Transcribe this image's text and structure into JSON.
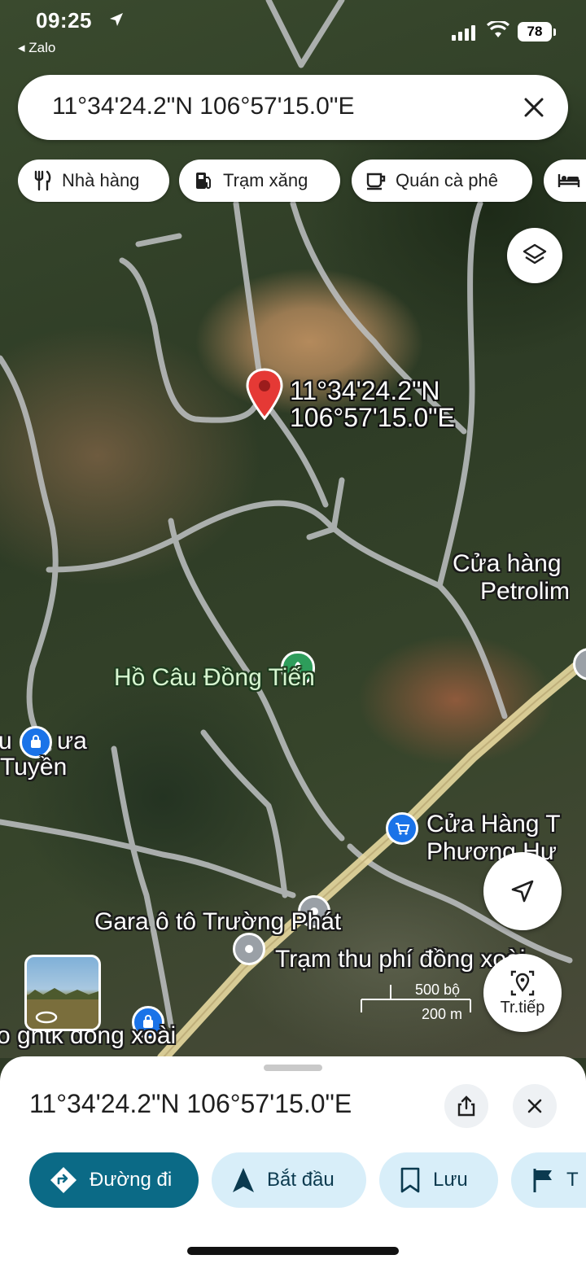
{
  "status_bar": {
    "time": "09:25",
    "back_app": "Zalo",
    "battery": "78"
  },
  "search": {
    "query": "11°34'24.2\"N 106°57'15.0\"E"
  },
  "chips": [
    {
      "label": "Nhà hàng",
      "icon": "restaurant-icon"
    },
    {
      "label": "Trạm xăng",
      "icon": "gas-station-icon"
    },
    {
      "label": "Quán cà phê",
      "icon": "coffee-icon"
    },
    {
      "label": "",
      "icon": "hotel-icon"
    }
  ],
  "map": {
    "pin_label_line1": "11°34'24.2\"N",
    "pin_label_line2": "106°57'15.0\"E",
    "labels": {
      "cua_hang_petrolimex_1": "Cửa hàng",
      "cua_hang_petrolimex_2": "Petrolim",
      "ho_cau": "Hồ Câu Đồng Tiến",
      "left_poi_1": "u",
      "left_poi_1b": "ưa",
      "left_poi_2": "Tuyền",
      "cua_hang_t_1": "Cửa Hàng T",
      "cua_hang_t_2": "Phương Hư",
      "gara": "Gara ô tô Trường Phát",
      "tram_thu_phi": "Trạm thu phí đồng xoài",
      "bottom_left": "o gntk đồng xoài"
    },
    "scale": {
      "top": "500 bộ",
      "bottom": "200 m"
    },
    "next_button": "Tr.tiếp",
    "colors": {
      "road": "#c8c8c8",
      "highway": "#e8d9a0",
      "pin": "#e53935",
      "poi_blue": "#1a73e8",
      "poi_green": "#2e9d5b",
      "poi_gray": "#9aa0a6"
    }
  },
  "sheet": {
    "title": "11°34'24.2\"N 106°57'15.0\"E",
    "actions": [
      {
        "label": "Đường đi",
        "icon": "directions-icon"
      },
      {
        "label": "Bắt đầu",
        "icon": "navigation-arrow-icon"
      },
      {
        "label": "Lưu",
        "icon": "bookmark-icon"
      },
      {
        "label": "T",
        "icon": "flag-icon"
      }
    ]
  }
}
